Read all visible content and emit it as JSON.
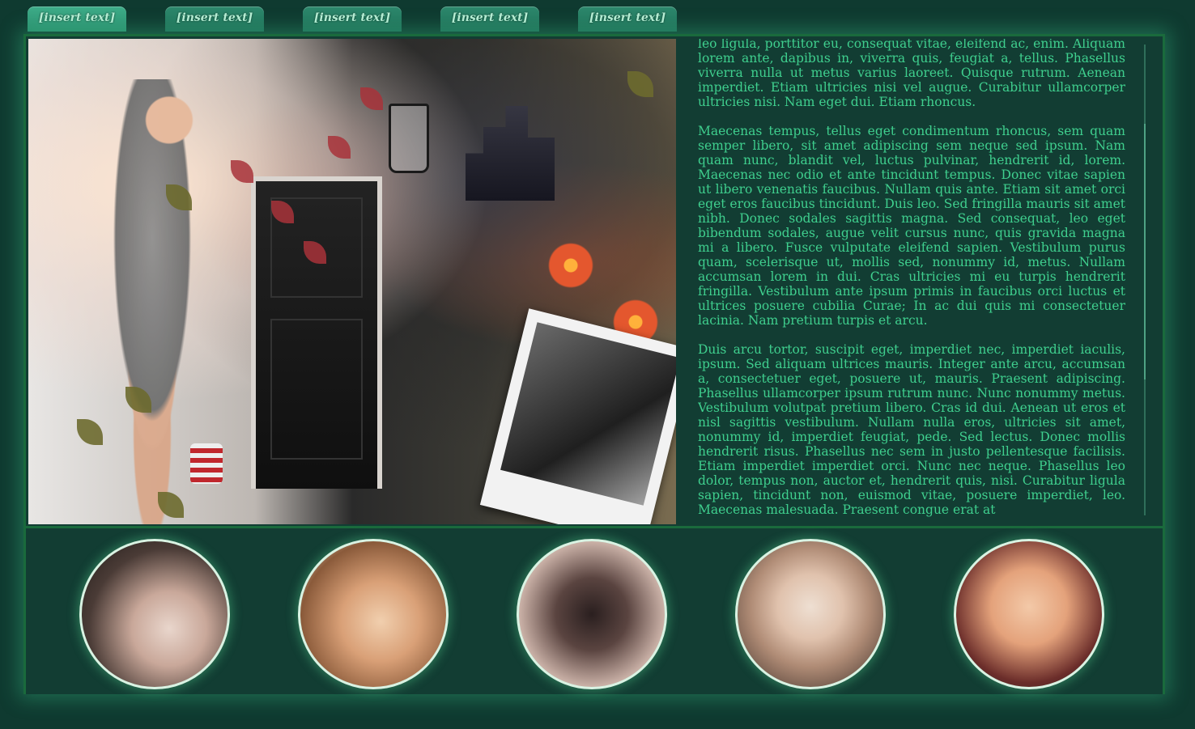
{
  "nav": {
    "tabs": [
      {
        "label": "[insert text]"
      },
      {
        "label": "[insert text]"
      },
      {
        "label": "[insert text]"
      },
      {
        "label": "[insert text]"
      },
      {
        "label": "[insert text]"
      }
    ]
  },
  "content": {
    "paragraphs": [
      "leo ligula, porttitor eu, consequat vitae, eleifend ac, enim. Aliquam lorem ante, dapibus in, viverra quis, feugiat a, tellus. Phasellus viverra nulla ut metus varius laoreet. Quisque rutrum. Aenean imperdiet. Etiam ultricies nisi vel augue. Curabitur ullamcorper ultricies nisi. Nam eget dui. Etiam rhoncus.",
      "Maecenas tempus, tellus eget condimentum rhoncus, sem quam semper libero, sit amet adipiscing sem neque sed ipsum. Nam quam nunc, blandit vel, luctus pulvinar, hendrerit id, lorem. Maecenas nec odio et ante tincidunt tempus. Donec vitae sapien ut libero venenatis faucibus. Nullam quis ante. Etiam sit amet orci eget eros faucibus tincidunt. Duis leo. Sed fringilla mauris sit amet nibh. Donec sodales sagittis magna. Sed consequat, leo eget bibendum sodales, augue velit cursus nunc, quis gravida magna mi a libero. Fusce vulputate eleifend sapien. Vestibulum purus quam, scelerisque ut, mollis sed, nonummy id, metus. Nullam accumsan lorem in dui. Cras ultricies mi eu turpis hendrerit fringilla. Vestibulum ante ipsum primis in faucibus orci luctus et ultrices posuere cubilia Curae; In ac dui quis mi consectetuer lacinia. Nam pretium turpis et arcu.",
      "Duis arcu tortor, suscipit eget, imperdiet nec, imperdiet iaculis, ipsum. Sed aliquam ultrices mauris. Integer ante arcu, accumsan a, consectetuer eget, posuere ut, mauris. Praesent adipiscing. Phasellus ullamcorper ipsum rutrum nunc. Nunc nonummy metus. Vestibulum volutpat pretium libero. Cras id dui. Aenean ut eros et nisl sagittis vestibulum. Nullam nulla eros, ultricies sit amet, nonummy id, imperdiet feugiat, pede. Sed lectus. Donec mollis hendrerit risus. Phasellus nec sem in justo pellentesque facilisis. Etiam imperdiet imperdiet orci. Nunc nec neque. Phasellus leo dolor, tempus non, auctor et, hendrerit quis, nisi. Curabitur ligula sapien, tincidunt non, euismod vitae, posuere imperdiet, leo. Maecenas malesuada. Praesent congue erat at"
    ]
  },
  "colors": {
    "background": "#0f3a30",
    "panel": "#123d33",
    "border": "#1a6a3c",
    "text": "#3fcf8e",
    "tab": "#2e8a6e"
  },
  "gallery": {
    "items": [
      {
        "icon": "portrait-photo-1"
      },
      {
        "icon": "portrait-photo-2"
      },
      {
        "icon": "portrait-photo-3"
      },
      {
        "icon": "portrait-photo-4"
      },
      {
        "icon": "portrait-photo-5"
      }
    ]
  }
}
